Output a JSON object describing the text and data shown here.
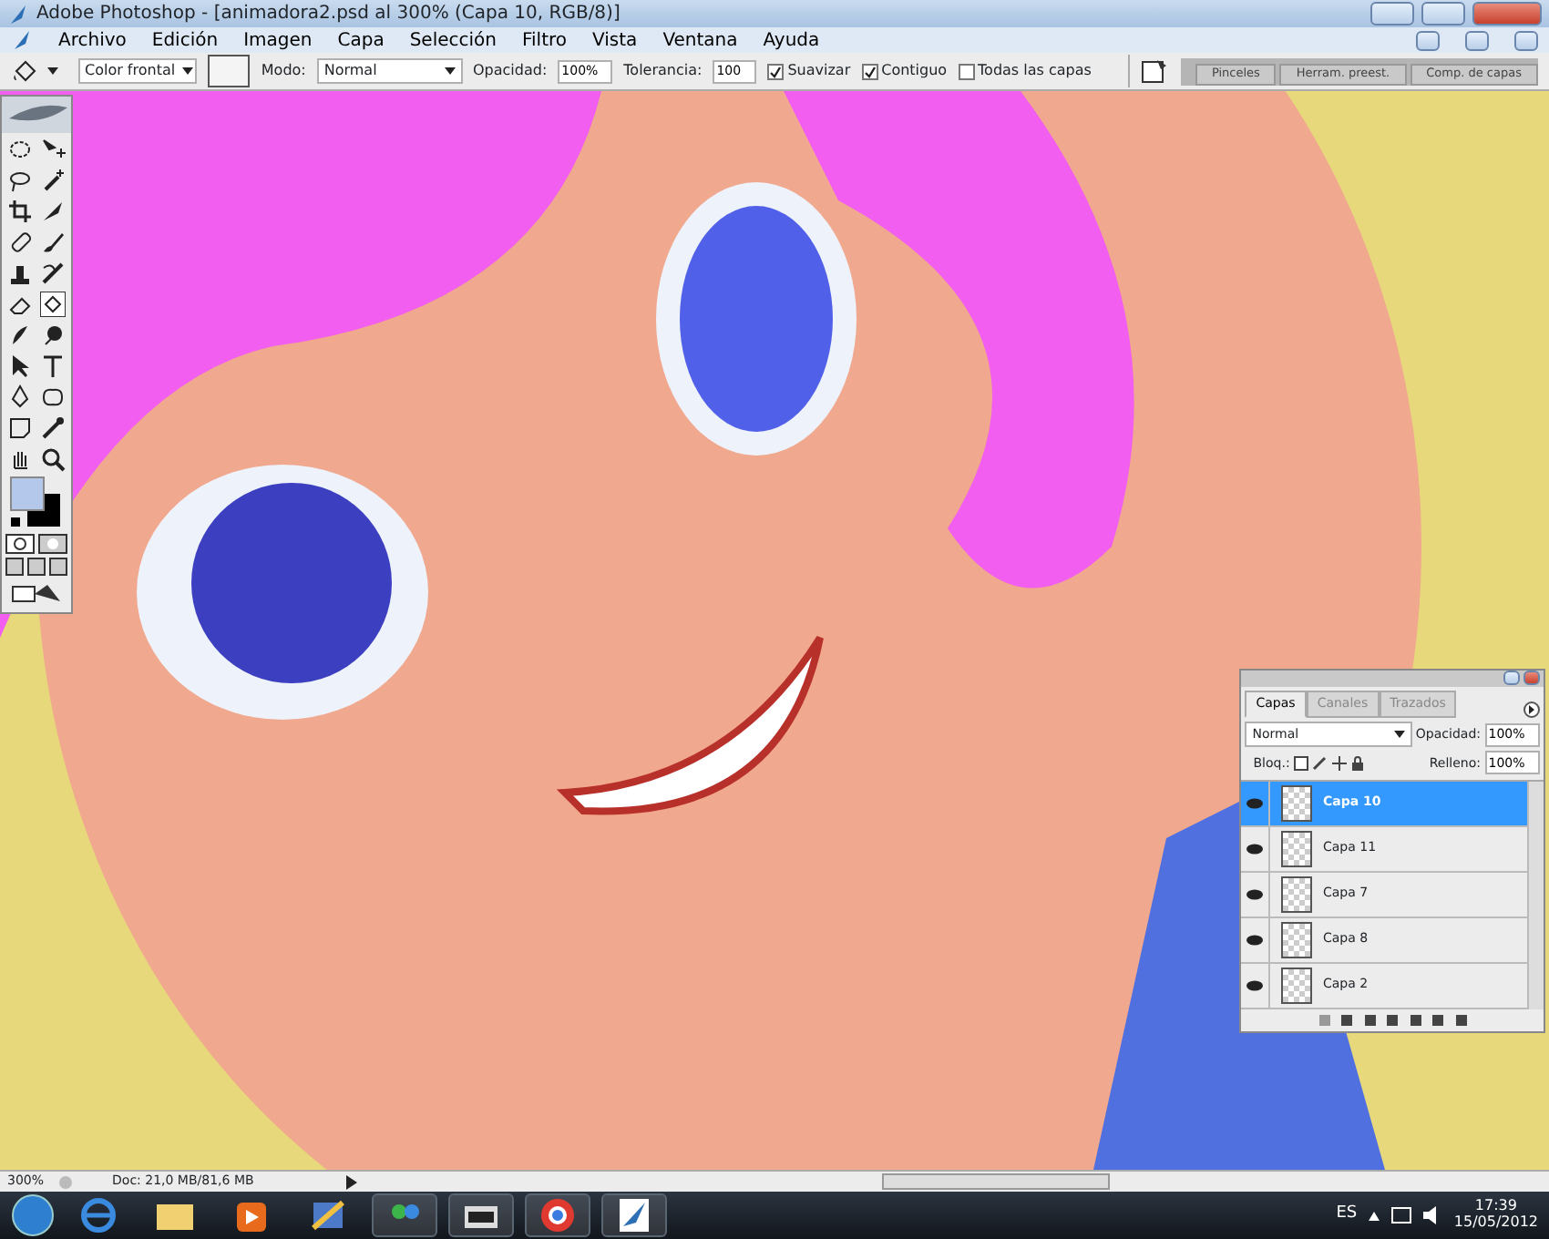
{
  "window": {
    "title": "Adobe Photoshop - [animadora2.psd al 300% (Capa 10, RGB/8)]"
  },
  "menu": [
    "Archivo",
    "Edición",
    "Imagen",
    "Capa",
    "Selección",
    "Filtro",
    "Vista",
    "Ventana",
    "Ayuda"
  ],
  "options_bar": {
    "fill_source": "Color frontal",
    "mode_label": "Modo:",
    "mode": "Normal",
    "opacity_label": "Opacidad:",
    "opacity": "100%",
    "tolerance_label": "Tolerancia:",
    "tolerance": "100",
    "checkboxes": [
      {
        "label": "Suavizar",
        "checked": true
      },
      {
        "label": "Contiguo",
        "checked": true
      },
      {
        "label": "Todas las capas",
        "checked": false
      }
    ]
  },
  "palette_well": {
    "tabs": [
      "Pinceles",
      "Herram. preest.",
      "Comp. de capas"
    ]
  },
  "layers_panel": {
    "tabs": [
      {
        "label": "Capas",
        "selected": true
      },
      {
        "label": "Canales",
        "selected": false
      },
      {
        "label": "Trazados",
        "selected": false
      }
    ],
    "blend_mode": "Normal",
    "opacity_label": "Opacidad:",
    "opacity": "100%",
    "lock_label": "Bloq.:",
    "fill_label": "Relleno:",
    "fill": "100%",
    "layers": [
      {
        "name": "Capa 10",
        "selected": true,
        "visible": true
      },
      {
        "name": "Capa 11",
        "selected": false,
        "visible": true
      },
      {
        "name": "Capa 7",
        "selected": false,
        "visible": true
      },
      {
        "name": "Capa 8",
        "selected": false,
        "visible": true
      },
      {
        "name": "Capa 2",
        "selected": false,
        "visible": true
      }
    ]
  },
  "status_bar": {
    "zoom": "300%",
    "doc_info": "Doc: 21,0 MB/81,6 MB"
  },
  "taskbar": {
    "language": "ES",
    "time": "17:39",
    "date": "15/05/2012"
  }
}
